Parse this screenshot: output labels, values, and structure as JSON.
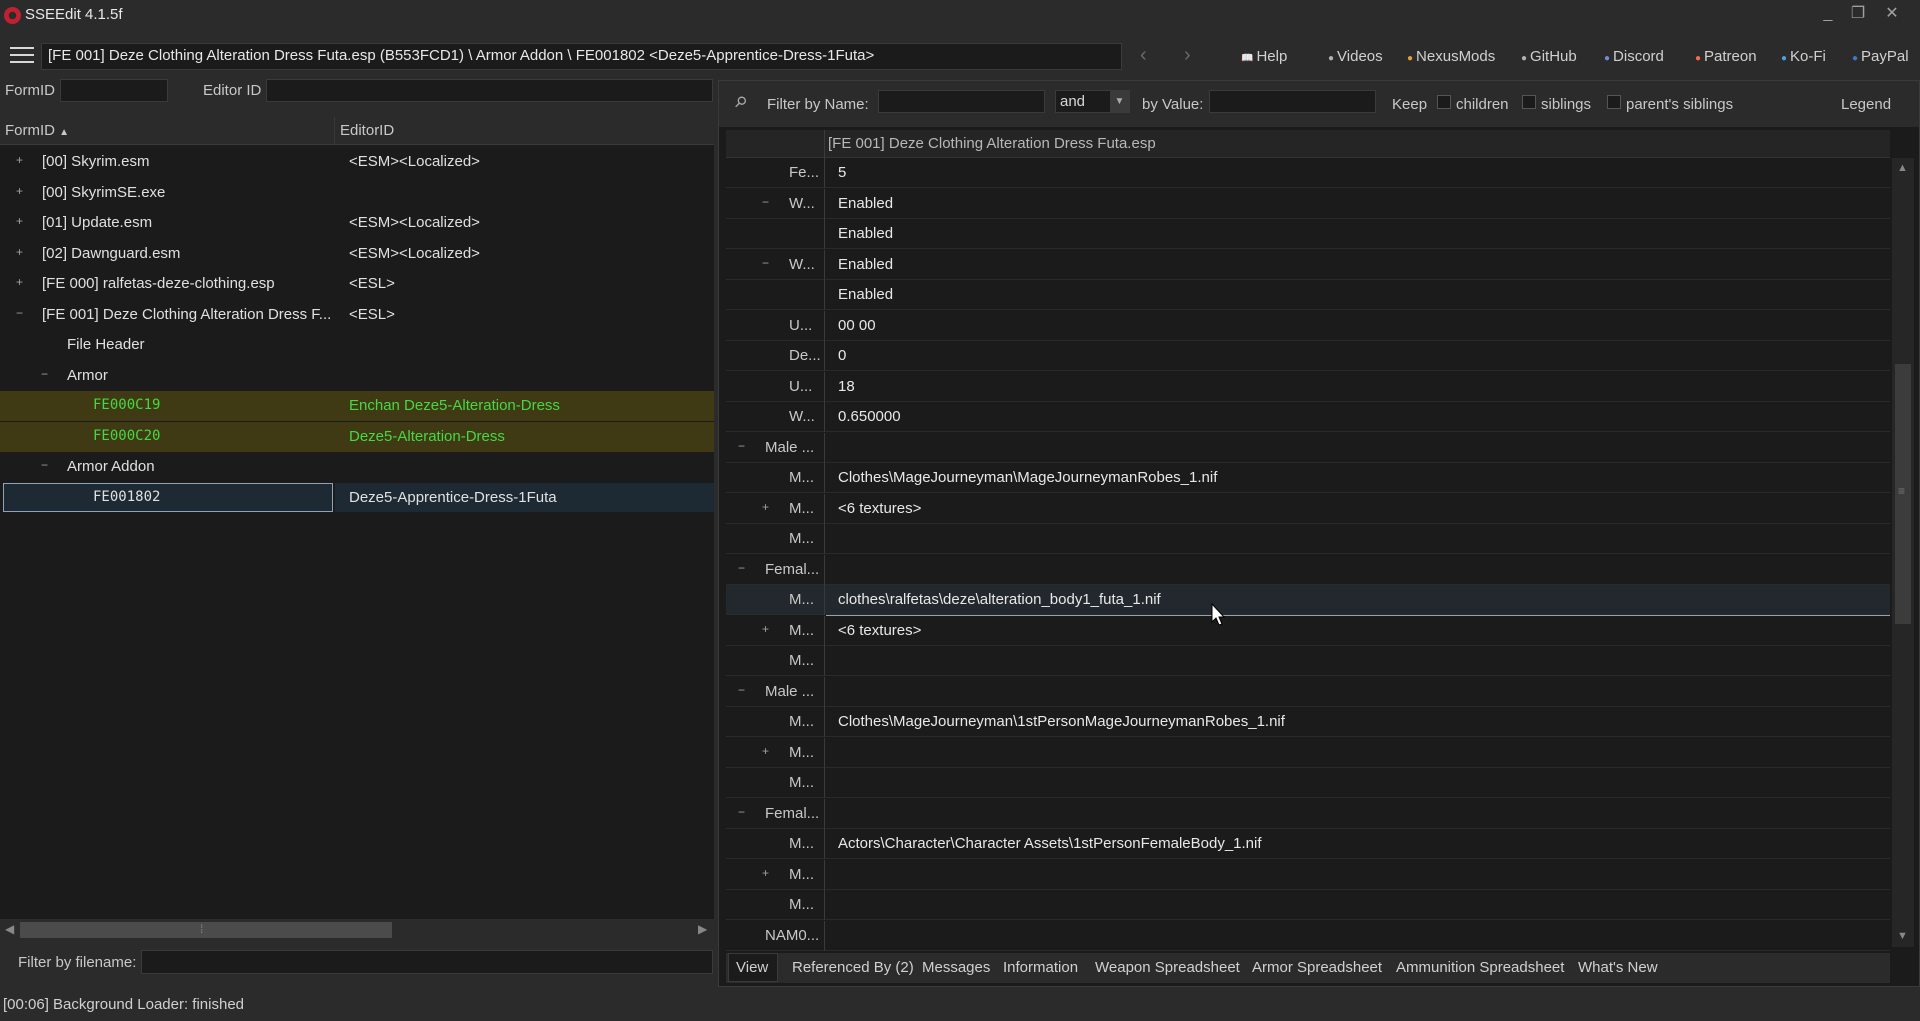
{
  "window": {
    "title": "SSEEdit 4.1.5f",
    "controls": [
      "_",
      "❐",
      "✕"
    ]
  },
  "toolbar": {
    "path": "[FE 001] Deze Clothing Alteration Dress Futa.esp (B553FCD1) \\ Armor Addon \\ FE001802 <Deze5-Apprentice-Dress-1Futa>",
    "back": "‹",
    "forward": "›",
    "links": [
      {
        "label": "Help",
        "icon": "book-icon",
        "color": "#e0c080"
      },
      {
        "label": "Videos",
        "icon": "video-icon",
        "color": "#b0b0b0"
      },
      {
        "label": "NexusMods",
        "icon": "nexus-icon",
        "color": "#e0a040"
      },
      {
        "label": "GitHub",
        "icon": "github-icon",
        "color": "#b0b0b0"
      },
      {
        "label": "Discord",
        "icon": "discord-icon",
        "color": "#7289da"
      },
      {
        "label": "Patreon",
        "icon": "patreon-icon",
        "color": "#f96854"
      },
      {
        "label": "Ko-Fi",
        "icon": "kofi-icon",
        "color": "#4aa0e0"
      },
      {
        "label": "PayPal",
        "icon": "paypal-icon",
        "color": "#3b7bbf"
      }
    ]
  },
  "left": {
    "formid_label": "FormID",
    "editorid_label": "Editor ID",
    "columns": [
      "FormID",
      "EditorID"
    ],
    "rows": [
      {
        "formid": "[00] Skyrim.esm",
        "editorid": "<ESM><Localized>",
        "exp": "+",
        "level": 0
      },
      {
        "formid": "[00] SkyrimSE.exe",
        "editorid": "",
        "exp": "+",
        "level": 0
      },
      {
        "formid": "[01] Update.esm",
        "editorid": "<ESM><Localized>",
        "exp": "+",
        "level": 0
      },
      {
        "formid": "[02] Dawnguard.esm",
        "editorid": "<ESM><Localized>",
        "exp": "+",
        "level": 0
      },
      {
        "formid": "[FE 000] ralfetas-deze-clothing.esp",
        "editorid": "<ESL>",
        "exp": "+",
        "level": 0
      },
      {
        "formid": "[FE 001] Deze Clothing Alteration Dress F...",
        "editorid": "<ESL>",
        "exp": "−",
        "level": 0
      },
      {
        "formid": "File Header",
        "editorid": "",
        "exp": "",
        "level": 1
      },
      {
        "formid": "Armor",
        "editorid": "",
        "exp": "−",
        "level": 1
      },
      {
        "formid": "FE000C19",
        "editorid": "Enchan Deze5-Alteration-Dress",
        "exp": "",
        "level": 2
      },
      {
        "formid": "FE000C20",
        "editorid": "Deze5-Alteration-Dress",
        "exp": "",
        "level": 2
      },
      {
        "formid": "Armor Addon",
        "editorid": "",
        "exp": "−",
        "level": 1
      },
      {
        "formid": "FE001802",
        "editorid": "Deze5-Apprentice-Dress-1Futa",
        "exp": "",
        "level": 2
      }
    ],
    "filter_label": "Filter by filename:",
    "scroll_grip": "⁞"
  },
  "filter": {
    "pin": "pin-icon",
    "name_label": "Filter by Name:",
    "op_value": "and",
    "value_label": "by Value:",
    "keep_label": "Keep",
    "children": "children",
    "siblings": "siblings",
    "parents_siblings": "parent's siblings",
    "legend": "Legend"
  },
  "right": {
    "header": "[FE 001] Deze Clothing Alteration Dress Futa.esp",
    "rows": [
      {
        "key": "Fe...",
        "value": "5",
        "exp": "",
        "indent": 2
      },
      {
        "key": "W...",
        "value": "Enabled",
        "exp": "−",
        "indent": 2
      },
      {
        "key": "",
        "value": "Enabled",
        "exp": "",
        "indent": 3
      },
      {
        "key": "W...",
        "value": "Enabled",
        "exp": "−",
        "indent": 2
      },
      {
        "key": "",
        "value": "Enabled",
        "exp": "",
        "indent": 3
      },
      {
        "key": "U...",
        "value": "00 00",
        "exp": "",
        "indent": 2
      },
      {
        "key": "De...",
        "value": "0",
        "exp": "",
        "indent": 2
      },
      {
        "key": "U...",
        "value": "18",
        "exp": "",
        "indent": 2
      },
      {
        "key": "W...",
        "value": "0.650000",
        "exp": "",
        "indent": 2
      },
      {
        "key": "Male ...",
        "value": "",
        "exp": "−",
        "indent": 1
      },
      {
        "key": "M...",
        "value": "Clothes\\MageJourneyman\\MageJourneymanRobes_1.nif",
        "exp": "",
        "indent": 2
      },
      {
        "key": "M...",
        "value": "<6 textures>",
        "exp": "+",
        "indent": 2
      },
      {
        "key": "M...",
        "value": "",
        "exp": "",
        "indent": 2
      },
      {
        "key": "Femal...",
        "value": "",
        "exp": "−",
        "indent": 1
      },
      {
        "key": "M...",
        "value": "clothes\\ralfetas\\deze\\alteration_body1_futa_1.nif",
        "exp": "",
        "indent": 2
      },
      {
        "key": "M...",
        "value": "<6 textures>",
        "exp": "+",
        "indent": 2
      },
      {
        "key": "M...",
        "value": "",
        "exp": "",
        "indent": 2
      },
      {
        "key": "Male ...",
        "value": "",
        "exp": "−",
        "indent": 1
      },
      {
        "key": "M...",
        "value": "Clothes\\MageJourneyman\\1stPersonMageJourneymanRobes_1.nif",
        "exp": "",
        "indent": 2
      },
      {
        "key": "M...",
        "value": "",
        "exp": "+",
        "indent": 2
      },
      {
        "key": "M...",
        "value": "",
        "exp": "",
        "indent": 2
      },
      {
        "key": "Femal...",
        "value": "",
        "exp": "−",
        "indent": 1
      },
      {
        "key": "M...",
        "value": "Actors\\Character\\Character Assets\\1stPersonFemaleBody_1.nif",
        "exp": "",
        "indent": 2
      },
      {
        "key": "M...",
        "value": "",
        "exp": "+",
        "indent": 2
      },
      {
        "key": "M...",
        "value": "",
        "exp": "",
        "indent": 2
      },
      {
        "key": "NAM0...",
        "value": "",
        "exp": "",
        "indent": 1
      }
    ],
    "scroll_grip": "≡"
  },
  "tabs": [
    "View",
    "Referenced By (2)",
    "Messages",
    "Information",
    "Weapon Spreadsheet",
    "Armor Spreadsheet",
    "Ammunition Spreadsheet",
    "What's New"
  ],
  "status": "[00:06] Background Loader: finished"
}
